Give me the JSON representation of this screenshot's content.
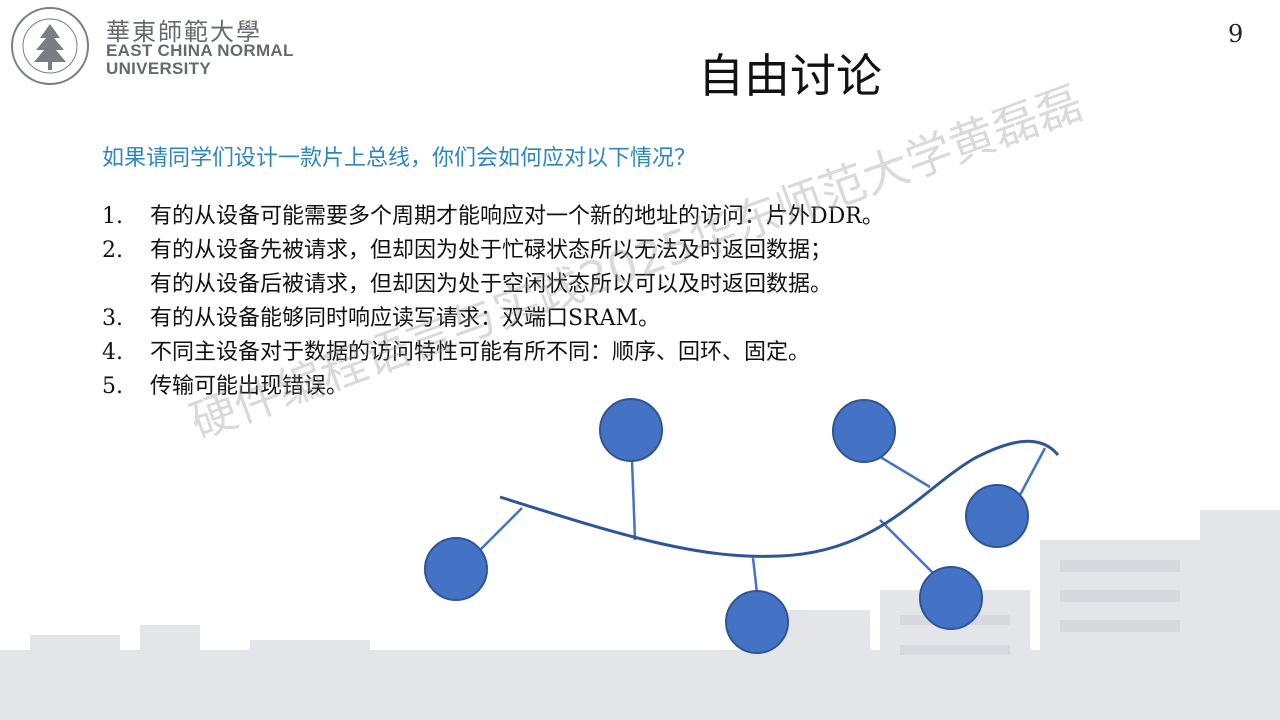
{
  "logo": {
    "cn": "華東師範大學",
    "en_line1": "EAST CHINA NORMAL",
    "en_line2": "UNIVERSITY"
  },
  "page_number": "9",
  "title": "自由讨论",
  "question": "如果请同学们设计一款片上总线，你们会如何应对以下情况？",
  "items": [
    {
      "num": "1.",
      "lines": [
        "有的从设备可能需要多个周期才能响应对一个新的地址的访问：片外DDR。"
      ]
    },
    {
      "num": "2.",
      "lines": [
        "有的从设备先被请求，但却因为处于忙碌状态所以无法及时返回数据；",
        "有的从设备后被请求，但却因为处于空闲状态所以可以及时返回数据。"
      ]
    },
    {
      "num": "3.",
      "lines": [
        "有的从设备能够同时响应读写请求：双端口SRAM。"
      ]
    },
    {
      "num": "4.",
      "lines": [
        "不同主设备对于数据的访问特性可能有所不同：顺序、回环、固定。"
      ]
    },
    {
      "num": "5.",
      "lines": [
        "传输可能出现错误。"
      ]
    }
  ],
  "watermark": "硬件编程语言与实践2025华东师范大学黄磊磊",
  "colors": {
    "question": "#2e86c1",
    "node_fill": "#4472c4",
    "node_stroke": "#2f5597",
    "bus": "#2f5597"
  }
}
